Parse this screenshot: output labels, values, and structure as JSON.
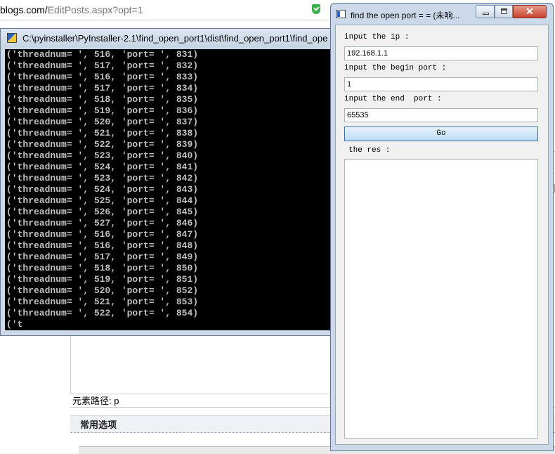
{
  "browser": {
    "url_host": "blogs.com/",
    "url_path": "EditPosts.aspx?opt=1",
    "element_path_label": "元素路径: p",
    "options_title": "常用选项"
  },
  "console": {
    "title": "C:\\pyinstaller\\PyInstaller-2.1\\find_open_port1\\dist\\find_open_port1\\find_ope",
    "lines": [
      "('threadnum= ', 516, 'port= ', 831)",
      "('threadnum= ', 517, 'port= ', 832)",
      "('threadnum= ', 516, 'port= ', 833)",
      "('threadnum= ', 517, 'port= ', 834)",
      "('threadnum= ', 518, 'port= ', 835)",
      "('threadnum= ', 519, 'port= ', 836)",
      "('threadnum= ', 520, 'port= ', 837)",
      "('threadnum= ', 521, 'port= ', 838)",
      "('threadnum= ', 522, 'port= ', 839)",
      "('threadnum= ', 523, 'port= ', 840)",
      "('threadnum= ', 524, 'port= ', 841)",
      "('threadnum= ', 523, 'port= ', 842)",
      "('threadnum= ', 524, 'port= ', 843)",
      "('threadnum= ', 525, 'port= ', 844)",
      "('threadnum= ', 526, 'port= ', 845)",
      "('threadnum= ', 527, 'port= ', 846)",
      "('threadnum= ', 516, 'port= ', 847)",
      "('threadnum= ', 516, 'port= ', 848)",
      "('threadnum= ', 517, 'port= ', 849)",
      "('threadnum= ', 518, 'port= ', 850)",
      "('threadnum= ', 519, 'port= ', 851)",
      "('threadnum= ', 520, 'port= ', 852)",
      "('threadnum= ', 521, 'port= ', 853)",
      "('threadnum= ', 522, 'port= ', 854)",
      "('t"
    ]
  },
  "dialog": {
    "title": "find the open port = = (未响...",
    "close_symbol": "✕",
    "ip_label": "input the ip :",
    "ip_value": "192.168.1.1",
    "begin_label": "input the begin port :",
    "begin_value": "1",
    "end_label": "input the end  port :",
    "end_value": "65535",
    "go_label": "Go",
    "res_label": "the res :"
  }
}
